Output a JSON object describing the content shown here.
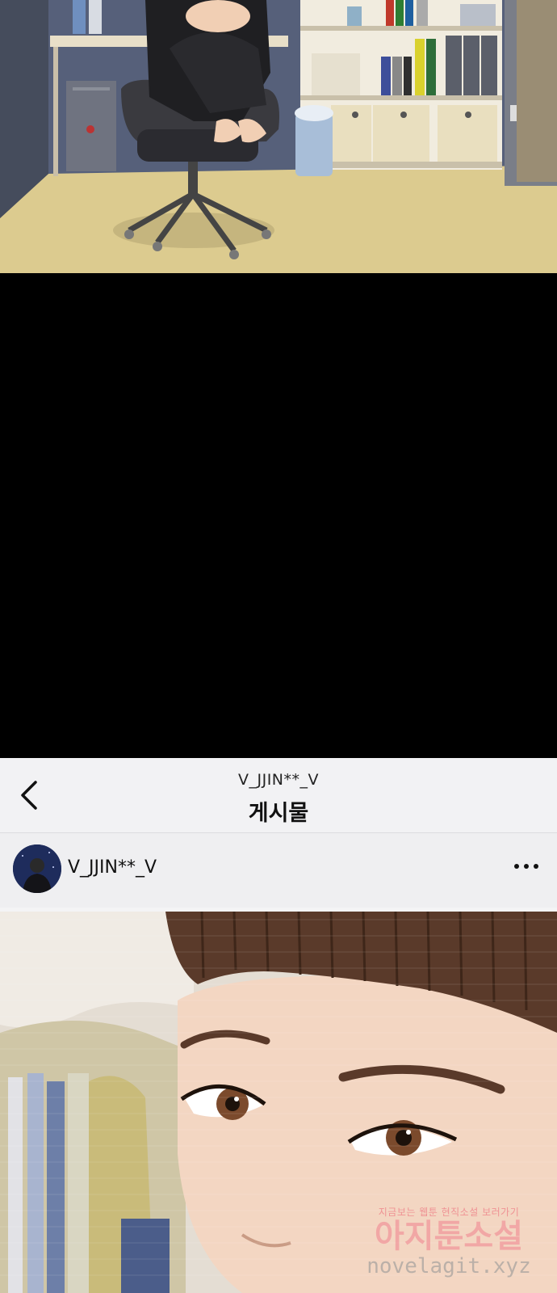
{
  "post_screen": {
    "nav": {
      "account_handle": "V_JJIN**_V",
      "title": "게시물"
    },
    "post": {
      "username": "V_JJIN**_V"
    }
  },
  "watermark": {
    "tagline": "지금보는 웹툰 현직소설 보러가기",
    "brand": "아지툰소설",
    "url": "novelagit.xyz"
  },
  "colors": {
    "floor": "#d9c98f",
    "wall": "#5a6274",
    "ui_background": "#f2f2f4",
    "skin": "#f1cfb4",
    "hair": "#5a3a2a"
  }
}
